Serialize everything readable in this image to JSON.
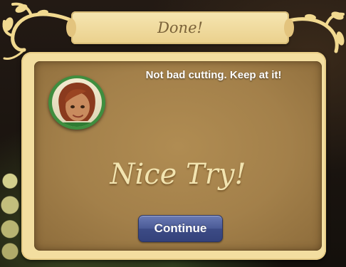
{
  "dialog": {
    "title": "Done!",
    "message": "Not bad cutting. Keep at it!",
    "result": "Nice Try!",
    "continue_label": "Continue"
  },
  "colors": {
    "frame": "#f3dea0",
    "panel": "#a3804a",
    "button": "#4a5a96",
    "avatar_ring": "#3f8e3f"
  },
  "icons": {
    "avatar": "character-portrait-icon",
    "ornament": "vine-ornament-icon"
  }
}
